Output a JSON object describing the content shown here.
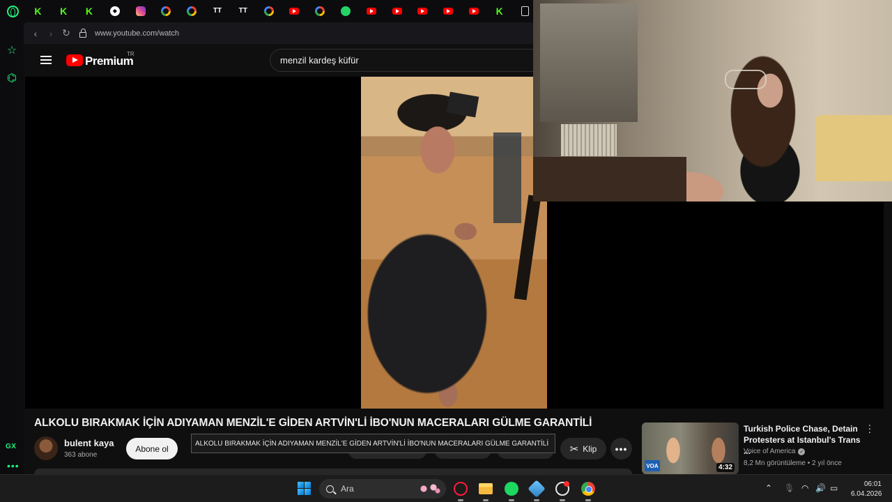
{
  "browser": {
    "tabs": [
      {
        "icon": "opera-gx-icon",
        "kind": "opera"
      },
      {
        "icon": "kick-icon",
        "kind": "kick",
        "glyph": "K"
      },
      {
        "icon": "kick-icon",
        "kind": "kick",
        "glyph": "K"
      },
      {
        "icon": "kick-icon",
        "kind": "kick",
        "glyph": "K"
      },
      {
        "icon": "app-icon",
        "kind": "misc",
        "glyph": "◆"
      },
      {
        "icon": "instagram-icon",
        "kind": "insta"
      },
      {
        "icon": "google-icon",
        "kind": "google"
      },
      {
        "icon": "google-icon",
        "kind": "google"
      },
      {
        "icon": "twitch-tracker-icon",
        "kind": "tw",
        "glyph": "TT"
      },
      {
        "icon": "twitch-tracker-icon",
        "kind": "tw",
        "glyph": "TT"
      },
      {
        "icon": "google-icon",
        "kind": "google"
      },
      {
        "icon": "youtube-icon",
        "kind": "yt"
      },
      {
        "icon": "google-icon",
        "kind": "google"
      },
      {
        "icon": "whatsapp-icon",
        "kind": "wa"
      },
      {
        "icon": "youtube-icon",
        "kind": "yt"
      },
      {
        "icon": "youtube-icon",
        "kind": "yt"
      },
      {
        "icon": "youtube-icon",
        "kind": "yt"
      },
      {
        "icon": "youtube-icon",
        "kind": "yt"
      },
      {
        "icon": "youtube-icon",
        "kind": "yt"
      },
      {
        "icon": "kick-icon",
        "kind": "kick",
        "glyph": "K"
      },
      {
        "icon": "document-icon",
        "kind": "doc"
      }
    ],
    "url": "www.youtube.com/watch",
    "sidebar_label": "GX",
    "accent_color": "#21f27a"
  },
  "youtube": {
    "brand": "Premium",
    "region": "TR",
    "search_query": "menzil kardeş küfür"
  },
  "video": {
    "title": "ALKOLU BIRAKMAK İÇİN ADIYAMAN MENZİL'E GİDEN ARTVİN'Lİ İBO'NUN MACERALARI GÜLME GARANTİLİ",
    "channel_name": "bulent kaya",
    "subscribers": "363 abone",
    "subscribe_label": "Abone ol",
    "tooltip": "ALKOLU BIRAKMAK İÇİN ADIYAMAN MENZİL'E  GİDEN ARTVİN'Lİ İBO'NUN MACERALARI GÜLME GARANTİLİ",
    "clip_label": "Klip",
    "more_label": "•••"
  },
  "recommended": {
    "title": "Turkish Police Chase, Detain Protesters at Istanbul's Trans ...",
    "channel": "Voice of America",
    "meta": "8,2 Mn görüntüleme • 2 yıl önce",
    "duration": "4:32",
    "badge": "VOA"
  },
  "taskbar": {
    "search_placeholder": "Ara",
    "time": "06:01",
    "date": "6.04.2026"
  }
}
